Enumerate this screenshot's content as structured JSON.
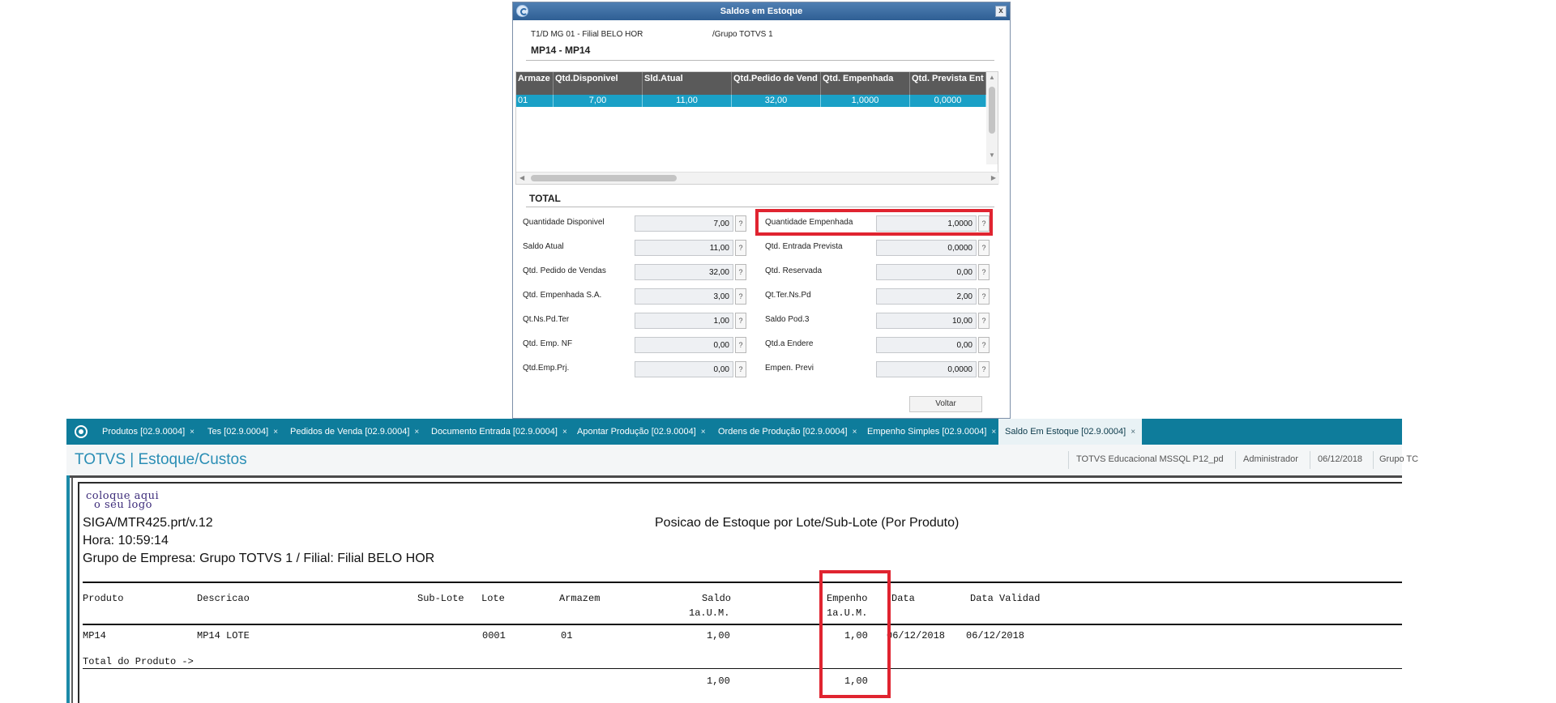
{
  "dialog": {
    "title": "Saldos em Estoque",
    "close_label": "x",
    "branch_line": "T1/D MG 01  - Filial BELO HOR",
    "group_line": "/Grupo TOTVS 1",
    "product_title": "MP14 - MP14",
    "grid": {
      "columns": [
        "Armaze",
        "Qtd.Disponivel",
        "Sld.Atual",
        "Qtd.Pedido de Vend",
        "Qtd. Empenhada",
        "Qtd. Prevista Ent"
      ],
      "row": [
        "01",
        "7,00",
        "11,00",
        "32,00",
        "1,0000",
        "0,0000"
      ]
    },
    "total_label": "TOTAL",
    "fields_left": [
      {
        "label": "Quantidade Disponivel",
        "value": "7,00"
      },
      {
        "label": "Saldo Atual",
        "value": "11,00"
      },
      {
        "label": "Qtd. Pedido de Vendas",
        "value": "32,00"
      },
      {
        "label": "Qtd. Empenhada S.A.",
        "value": "3,00"
      },
      {
        "label": "Qt.Ns.Pd.Ter",
        "value": "1,00"
      },
      {
        "label": "Qtd. Emp. NF",
        "value": "0,00"
      },
      {
        "label": "Qtd.Emp.Prj.",
        "value": "0,00"
      }
    ],
    "fields_right": [
      {
        "label": "Quantidade Empenhada",
        "value": "1,0000"
      },
      {
        "label": "Qtd. Entrada Prevista",
        "value": "0,0000"
      },
      {
        "label": "Qtd. Reservada",
        "value": "0,00"
      },
      {
        "label": "Qt.Ter.Ns.Pd",
        "value": "2,00"
      },
      {
        "label": "Saldo Pod.3",
        "value": "10,00"
      },
      {
        "label": "Qtd.a Endere",
        "value": "0,00"
      },
      {
        "label": "Empen. Previ",
        "value": "0,0000"
      }
    ],
    "help_label": "?",
    "voltar_label": "Voltar"
  },
  "app": {
    "tabs": [
      "Produtos [02.9.0004]",
      "Tes [02.9.0004]",
      "Pedidos de Venda [02.9.0004]",
      "Documento Entrada [02.9.0004]",
      "Apontar Produção [02.9.0004]",
      "Ordens de Produção [02.9.0004]",
      "Empenho Simples [02.9.0004]",
      "Saldo Em Estoque [02.9.0004]"
    ],
    "tab_close": "×",
    "title": "TOTVS | Estoque/Custos",
    "environment": "TOTVS Educacional MSSQL P12_pd",
    "user": "Administrador",
    "date": "06/12/2018",
    "group": "Grupo TC"
  },
  "report": {
    "logo_line1": "coloque aqui",
    "logo_line2": "o seu logo",
    "program": "SIGA/MTR425.prt/v.12",
    "title": "Posicao de Estoque por Lote/Sub-Lote (Por Produto)",
    "time": "Hora: 10:59:14",
    "company": "Grupo de Empresa: Grupo TOTVS 1 / Filial: Filial BELO HOR",
    "col_produto": "Produto",
    "col_descricao": "Descricao",
    "col_sublote": "Sub-Lote",
    "col_lote": "Lote",
    "col_armazem": "Armazem",
    "col_saldo": "Saldo",
    "col_saldo_unit": "1a.U.M.",
    "col_empenho": "Empenho",
    "col_empenho_unit": "1a.U.M.",
    "col_data": "Data",
    "col_validade": "Data Validad",
    "row": {
      "produto": "MP14",
      "descricao": "MP14  LOTE",
      "lote": "0001",
      "armazem": "01",
      "saldo": "1,00",
      "empenho": "1,00",
      "data": "06/12/2018",
      "validade": "06/12/2018"
    },
    "total_label": "Total do Produto ->",
    "total_saldo": "1,00",
    "total_empenho": "1,00"
  },
  "colors": {
    "highlight": "#e02430",
    "tabbar": "#0e7c9b",
    "grid_selected": "#1aa0c6"
  }
}
